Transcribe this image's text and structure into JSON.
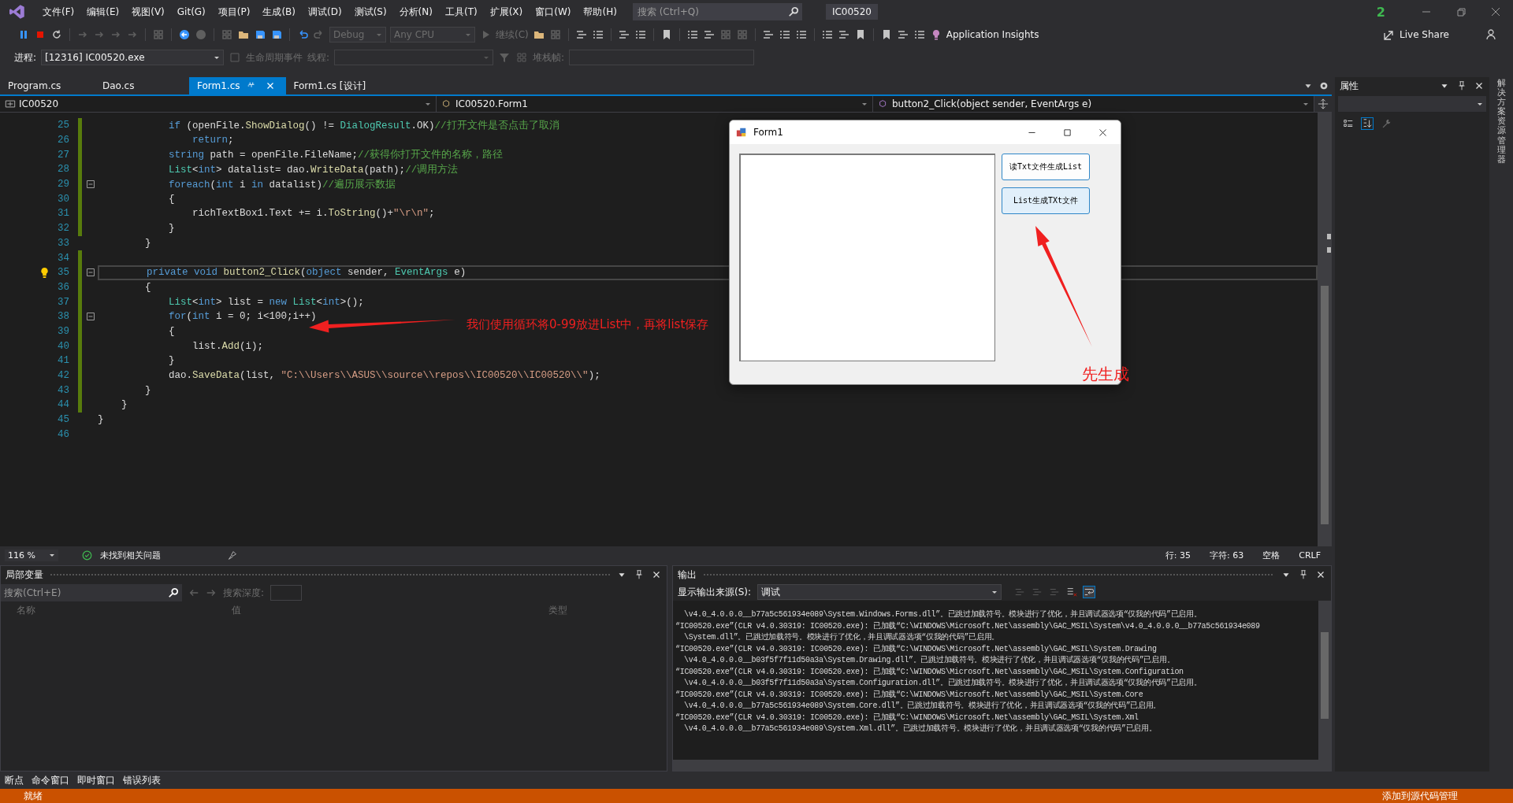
{
  "title_bar": {
    "menu": [
      "文件(F)",
      "编辑(E)",
      "视图(V)",
      "Git(G)",
      "项目(P)",
      "生成(B)",
      "调试(D)",
      "测试(S)",
      "分析(N)",
      "工具(T)",
      "扩展(X)",
      "窗口(W)",
      "帮助(H)"
    ],
    "search": {
      "placeholder": "搜索 (Ctrl+Q)"
    },
    "solution": "IC00520",
    "notifications": "2"
  },
  "toolbar": {
    "config": "Debug",
    "platform": "Any CPU",
    "continue": "继续(C)",
    "insights": "Application Insights",
    "live_share": "Live Share"
  },
  "debug_bar": {
    "process_label": "进程:",
    "process": "[12316] IC00520.exe",
    "lifecycle": "生命周期事件",
    "thread_label": "线程:",
    "stack_label": "堆栈帧:"
  },
  "tabs": [
    {
      "label": "Program.cs",
      "selected": false
    },
    {
      "label": "Dao.cs",
      "selected": false
    },
    {
      "label": "Form1.cs",
      "selected": true
    },
    {
      "label": "Form1.cs [设计]",
      "selected": false
    }
  ],
  "nav": {
    "project": "IC00520",
    "class": "IC00520.Form1",
    "member": "button2_Click(object sender, EventArgs e)"
  },
  "lines": [
    {
      "num": "25",
      "changed": true,
      "fold": false,
      "current": false,
      "bulb": false,
      "tokens": [
        {
          "kind": "kw",
          "text": "            if"
        },
        {
          "kind": "p",
          "text": " (openFile."
        },
        {
          "kind": "m",
          "text": "ShowDialog"
        },
        {
          "kind": "p",
          "text": "() != "
        },
        {
          "kind": "ty",
          "text": "DialogResult"
        },
        {
          "kind": "p",
          "text": ".OK)"
        },
        {
          "kind": "c",
          "text": "//打开文件是否点击了取消"
        }
      ]
    },
    {
      "num": "26",
      "changed": true,
      "fold": false,
      "current": false,
      "bulb": false,
      "tokens": [
        {
          "kind": "kw",
          "text": "                return"
        },
        {
          "kind": "p",
          "text": ";"
        }
      ]
    },
    {
      "num": "27",
      "changed": true,
      "fold": false,
      "current": false,
      "bulb": false,
      "tokens": [
        {
          "kind": "kw",
          "text": "            string"
        },
        {
          "kind": "p",
          "text": " path = openFile.FileName;"
        },
        {
          "kind": "c",
          "text": "//获得你打开文件的名称，路径"
        }
      ]
    },
    {
      "num": "28",
      "changed": true,
      "fold": false,
      "current": false,
      "bulb": false,
      "tokens": [
        {
          "kind": "ty",
          "text": "            List"
        },
        {
          "kind": "p",
          "text": "<"
        },
        {
          "kind": "kw",
          "text": "int"
        },
        {
          "kind": "p",
          "text": "> datalist= dao."
        },
        {
          "kind": "m",
          "text": "WriteData"
        },
        {
          "kind": "p",
          "text": "(path);"
        },
        {
          "kind": "c",
          "text": "//调用方法"
        }
      ]
    },
    {
      "num": "29",
      "changed": true,
      "fold": true,
      "current": false,
      "bulb": false,
      "tokens": [
        {
          "kind": "kw",
          "text": "            foreach"
        },
        {
          "kind": "p",
          "text": "("
        },
        {
          "kind": "kw",
          "text": "int"
        },
        {
          "kind": "p",
          "text": " i "
        },
        {
          "kind": "kw",
          "text": "in"
        },
        {
          "kind": "p",
          "text": " datalist)"
        },
        {
          "kind": "c",
          "text": "//遍历展示数据"
        }
      ]
    },
    {
      "num": "30",
      "changed": true,
      "fold": false,
      "current": false,
      "bulb": false,
      "tokens": [
        {
          "kind": "p",
          "text": "            {"
        }
      ]
    },
    {
      "num": "31",
      "changed": true,
      "fold": false,
      "current": false,
      "bulb": false,
      "tokens": [
        {
          "kind": "p",
          "text": "                richTextBox1.Text += i."
        },
        {
          "kind": "m",
          "text": "ToString"
        },
        {
          "kind": "p",
          "text": "()+"
        },
        {
          "kind": "s",
          "text": "\"\\r\\n\""
        },
        {
          "kind": "p",
          "text": ";"
        }
      ]
    },
    {
      "num": "32",
      "changed": true,
      "fold": false,
      "current": false,
      "bulb": false,
      "tokens": [
        {
          "kind": "p",
          "text": "            }"
        }
      ]
    },
    {
      "num": "33",
      "changed": false,
      "fold": false,
      "current": false,
      "bulb": false,
      "tokens": [
        {
          "kind": "p",
          "text": "        }"
        }
      ]
    },
    {
      "num": "34",
      "changed": true,
      "fold": false,
      "current": false,
      "bulb": false
    },
    {
      "num": "35",
      "changed": true,
      "fold": true,
      "current": true,
      "bulb": true,
      "tokens": [
        {
          "kind": "kw",
          "text": "        private void"
        },
        {
          "kind": "m",
          "text": " button2_Click"
        },
        {
          "kind": "p",
          "text": "("
        },
        {
          "kind": "kw",
          "text": "object"
        },
        {
          "kind": "p",
          "text": " sender, "
        },
        {
          "kind": "ty",
          "text": "EventArgs"
        },
        {
          "kind": "p",
          "text": " e)"
        }
      ]
    },
    {
      "num": "36",
      "changed": true,
      "fold": false,
      "current": false,
      "bulb": false,
      "tokens": [
        {
          "kind": "p",
          "text": "        {"
        }
      ]
    },
    {
      "num": "37",
      "changed": true,
      "fold": false,
      "current": false,
      "bulb": false,
      "tokens": [
        {
          "kind": "ty",
          "text": "            List"
        },
        {
          "kind": "p",
          "text": "<"
        },
        {
          "kind": "kw",
          "text": "int"
        },
        {
          "kind": "p",
          "text": "> list = "
        },
        {
          "kind": "kw",
          "text": "new"
        },
        {
          "kind": "ty",
          "text": " List"
        },
        {
          "kind": "p",
          "text": "<"
        },
        {
          "kind": "kw",
          "text": "int"
        },
        {
          "kind": "p",
          "text": ">();"
        }
      ]
    },
    {
      "num": "38",
      "changed": true,
      "fold": true,
      "current": false,
      "bulb": false,
      "tokens": [
        {
          "kind": "kw",
          "text": "            for"
        },
        {
          "kind": "p",
          "text": "("
        },
        {
          "kind": "kw",
          "text": "int"
        },
        {
          "kind": "p",
          "text": " i = 0; i<100;i++)"
        }
      ]
    },
    {
      "num": "39",
      "changed": true,
      "fold": false,
      "current": false,
      "bulb": false,
      "tokens": [
        {
          "kind": "p",
          "text": "            {"
        }
      ]
    },
    {
      "num": "40",
      "changed": true,
      "fold": false,
      "current": false,
      "bulb": false,
      "tokens": [
        {
          "kind": "p",
          "text": "                list."
        },
        {
          "kind": "m",
          "text": "Add"
        },
        {
          "kind": "p",
          "text": "(i);"
        }
      ]
    },
    {
      "num": "41",
      "changed": true,
      "fold": false,
      "current": false,
      "bulb": false,
      "tokens": [
        {
          "kind": "p",
          "text": "            }"
        }
      ]
    },
    {
      "num": "42",
      "changed": true,
      "fold": false,
      "current": false,
      "bulb": false,
      "tokens": [
        {
          "kind": "p",
          "text": "            dao."
        },
        {
          "kind": "m",
          "text": "SaveData"
        },
        {
          "kind": "p",
          "text": "(list, "
        },
        {
          "kind": "s",
          "text": "\"C:\\\\Users\\\\ASUS\\\\source\\\\repos\\\\IC00520\\\\IC00520\\\\\""
        },
        {
          "kind": "p",
          "text": ");"
        }
      ]
    },
    {
      "num": "43",
      "changed": true,
      "fold": false,
      "current": false,
      "bulb": false,
      "tokens": [
        {
          "kind": "p",
          "text": "        }"
        }
      ]
    },
    {
      "num": "44",
      "changed": true,
      "fold": false,
      "current": false,
      "bulb": false,
      "tokens": [
        {
          "kind": "p",
          "text": "    }"
        }
      ]
    },
    {
      "num": "45",
      "changed": false,
      "fold": false,
      "current": false,
      "bulb": false,
      "tokens": [
        {
          "kind": "p",
          "text": "}"
        }
      ]
    },
    {
      "num": "46",
      "changed": false,
      "fold": false,
      "current": false,
      "bulb": false
    }
  ],
  "editor_status": {
    "zoom": "116 %",
    "issues": "未找到相关问题",
    "line": "行: 35",
    "char": "字符: 63",
    "indent": "空格",
    "eol": "CRLF"
  },
  "form_window": {
    "title": "Form1",
    "buttons": [
      {
        "label": "读Txt文件生成List",
        "hover": false
      },
      {
        "label": "List生成TXt文件",
        "hover": true
      }
    ]
  },
  "annotations": [
    {
      "text": "我们使用循环将0-99放进List中，再将list保存"
    },
    {
      "text": "先生成"
    }
  ],
  "locals": {
    "title": "局部变量",
    "search_placeholder": "搜索(Ctrl+E)",
    "depth_label": "搜索深度:",
    "columns": [
      "名称",
      "值",
      "类型"
    ]
  },
  "output": {
    "title": "输出",
    "source_label": "显示输出来源(S):",
    "source": "调试",
    "lines": [
      {
        "kind": "cont",
        "text": "\\v4.0_4.0.0.0__b77a5c561934e089\\System.Windows.Forms.dll”。已跳过加载符号。模块进行了优化，并且调试器选项“仅我的代码”已启用。"
      },
      {
        "kind": "head",
        "text": "“IC00520.exe”(CLR v4.0.30319: IC00520.exe): 已加载“C:\\WINDOWS\\Microsoft.Net\\assembly\\GAC_MSIL\\System\\v4.0_4.0.0.0__b77a5c561934e089"
      },
      {
        "kind": "cont",
        "text": "\\System.dll”。已跳过加载符号。模块进行了优化，并且调试器选项“仅我的代码”已启用。"
      },
      {
        "kind": "head",
        "text": "“IC00520.exe”(CLR v4.0.30319: IC00520.exe): 已加载“C:\\WINDOWS\\Microsoft.Net\\assembly\\GAC_MSIL\\System.Drawing"
      },
      {
        "kind": "cont",
        "text": "\\v4.0_4.0.0.0__b03f5f7f11d50a3a\\System.Drawing.dll”。已跳过加载符号。模块进行了优化，并且调试器选项“仅我的代码”已启用。"
      },
      {
        "kind": "head",
        "text": "“IC00520.exe”(CLR v4.0.30319: IC00520.exe): 已加载“C:\\WINDOWS\\Microsoft.Net\\assembly\\GAC_MSIL\\System.Configuration"
      },
      {
        "kind": "cont",
        "text": "\\v4.0_4.0.0.0__b03f5f7f11d50a3a\\System.Configuration.dll”。已跳过加载符号。模块进行了优化，并且调试器选项“仅我的代码”已启用。"
      },
      {
        "kind": "head",
        "text": "“IC00520.exe”(CLR v4.0.30319: IC00520.exe): 已加载“C:\\WINDOWS\\Microsoft.Net\\assembly\\GAC_MSIL\\System.Core"
      },
      {
        "kind": "cont",
        "text": "\\v4.0_4.0.0.0__b77a5c561934e089\\System.Core.dll”。已跳过加载符号。模块进行了优化，并且调试器选项“仅我的代码”已启用。"
      },
      {
        "kind": "head",
        "text": "“IC00520.exe”(CLR v4.0.30319: IC00520.exe): 已加载“C:\\WINDOWS\\Microsoft.Net\\assembly\\GAC_MSIL\\System.Xml"
      },
      {
        "kind": "cont",
        "text": "\\v4.0_4.0.0.0__b77a5c561934e089\\System.Xml.dll”。已跳过加载符号。模块进行了优化，并且调试器选项“仅我的代码”已启用。"
      }
    ]
  },
  "bottom_tabs": [
    "断点",
    "命令窗口",
    "即时窗口",
    "错误列表"
  ],
  "properties": {
    "title": "属性"
  },
  "side_tab": "解决方案资源管理器",
  "status_bar": {
    "text": "就绪",
    "source_control": "添加到源代码管理"
  }
}
